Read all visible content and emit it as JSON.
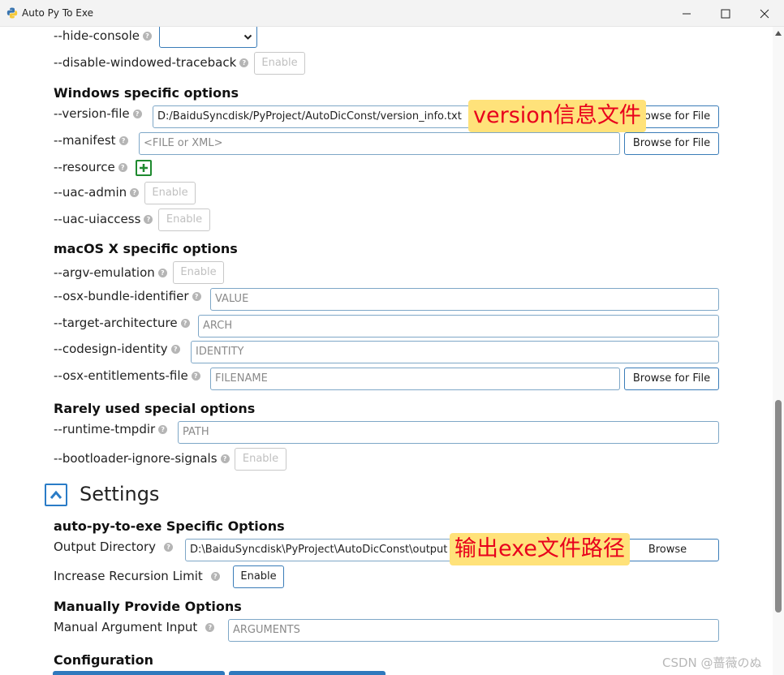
{
  "window": {
    "title": "Auto Py To Exe",
    "icon": "python-icon"
  },
  "rows": {
    "hide_console": {
      "label": "--hide-console"
    },
    "disable_windowed_traceback": {
      "label": "--disable-windowed-traceback",
      "button": "Enable"
    },
    "version_file": {
      "label": "--version-file",
      "value": "D:/BaiduSyncdisk/PyProject/AutoDicConst/version_info.txt",
      "button": "Browse for File"
    },
    "manifest": {
      "label": "--manifest",
      "placeholder": "<FILE or XML>",
      "button": "Browse for File"
    },
    "resource": {
      "label": "--resource"
    },
    "uac_admin": {
      "label": "--uac-admin",
      "button": "Enable"
    },
    "uac_uiaccess": {
      "label": "--uac-uiaccess",
      "button": "Enable"
    },
    "argv_emulation": {
      "label": "--argv-emulation",
      "button": "Enable"
    },
    "osx_bundle_identifier": {
      "label": "--osx-bundle-identifier",
      "placeholder": "VALUE"
    },
    "target_architecture": {
      "label": "--target-architecture",
      "placeholder": "ARCH"
    },
    "codesign_identity": {
      "label": "--codesign-identity",
      "placeholder": "IDENTITY"
    },
    "osx_entitlements_file": {
      "label": "--osx-entitlements-file",
      "placeholder": "FILENAME",
      "button": "Browse for File"
    },
    "runtime_tmpdir": {
      "label": "--runtime-tmpdir",
      "placeholder": "PATH"
    },
    "bootloader_ignore_signals": {
      "label": "--bootloader-ignore-signals",
      "button": "Enable"
    }
  },
  "headings": {
    "windows": "Windows specific options",
    "macos": "macOS X specific options",
    "rare": "Rarely used special options",
    "autopy": "auto-py-to-exe Specific Options",
    "manual": "Manually Provide Options",
    "config": "Configuration"
  },
  "settings": {
    "title": "Settings",
    "output_directory": {
      "label": "Output Directory",
      "value": "D:\\BaiduSyncdisk\\PyProject\\AutoDicConst\\output",
      "button": "Browse"
    },
    "increase_recursion_limit": {
      "label": "Increase Recursion Limit",
      "button": "Enable"
    },
    "manual_argument_input": {
      "label": "Manual Argument Input",
      "placeholder": "ARGUMENTS"
    }
  },
  "annotations": {
    "version": "version信息文件",
    "output": "输出exe文件路径"
  },
  "watermark": "CSDN @蔷薇のぬ",
  "colors": {
    "accent": "#3a7cb8",
    "annotation_bg": "#ffe27a",
    "annotation_text": "#e8001c",
    "plus_green": "#1e8a2f"
  }
}
